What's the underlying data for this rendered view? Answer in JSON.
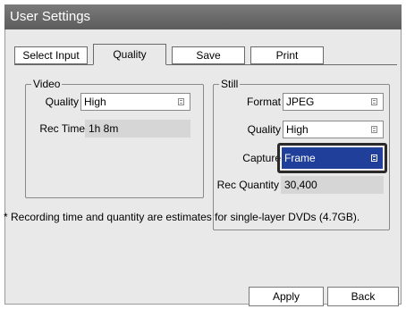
{
  "window": {
    "title": "User Settings"
  },
  "tabs": [
    "Select Input",
    "Quality",
    "Save",
    "Print"
  ],
  "active_tab": "Quality",
  "video": {
    "title": "Video",
    "quality_label": "Quality",
    "quality_value": "High",
    "rec_time_label": "Rec Time",
    "rec_time_value": "1h 8m"
  },
  "still": {
    "title": "Still",
    "format_label": "Format",
    "format_value": "JPEG",
    "quality_label": "Quality",
    "quality_value": "High",
    "capture_label": "Capture",
    "capture_value": "Frame",
    "rec_quantity_label": "Rec Quantity",
    "rec_quantity_value": "30,400"
  },
  "note": "* Recording time and quantity are estimates for single-layer DVDs (4.7GB).",
  "buttons": {
    "apply": "Apply",
    "back": "Back"
  },
  "colors": {
    "title_bar": "#6a6a6a",
    "selected_field": "#1f3f9a",
    "panel": "#e9e9e9"
  }
}
